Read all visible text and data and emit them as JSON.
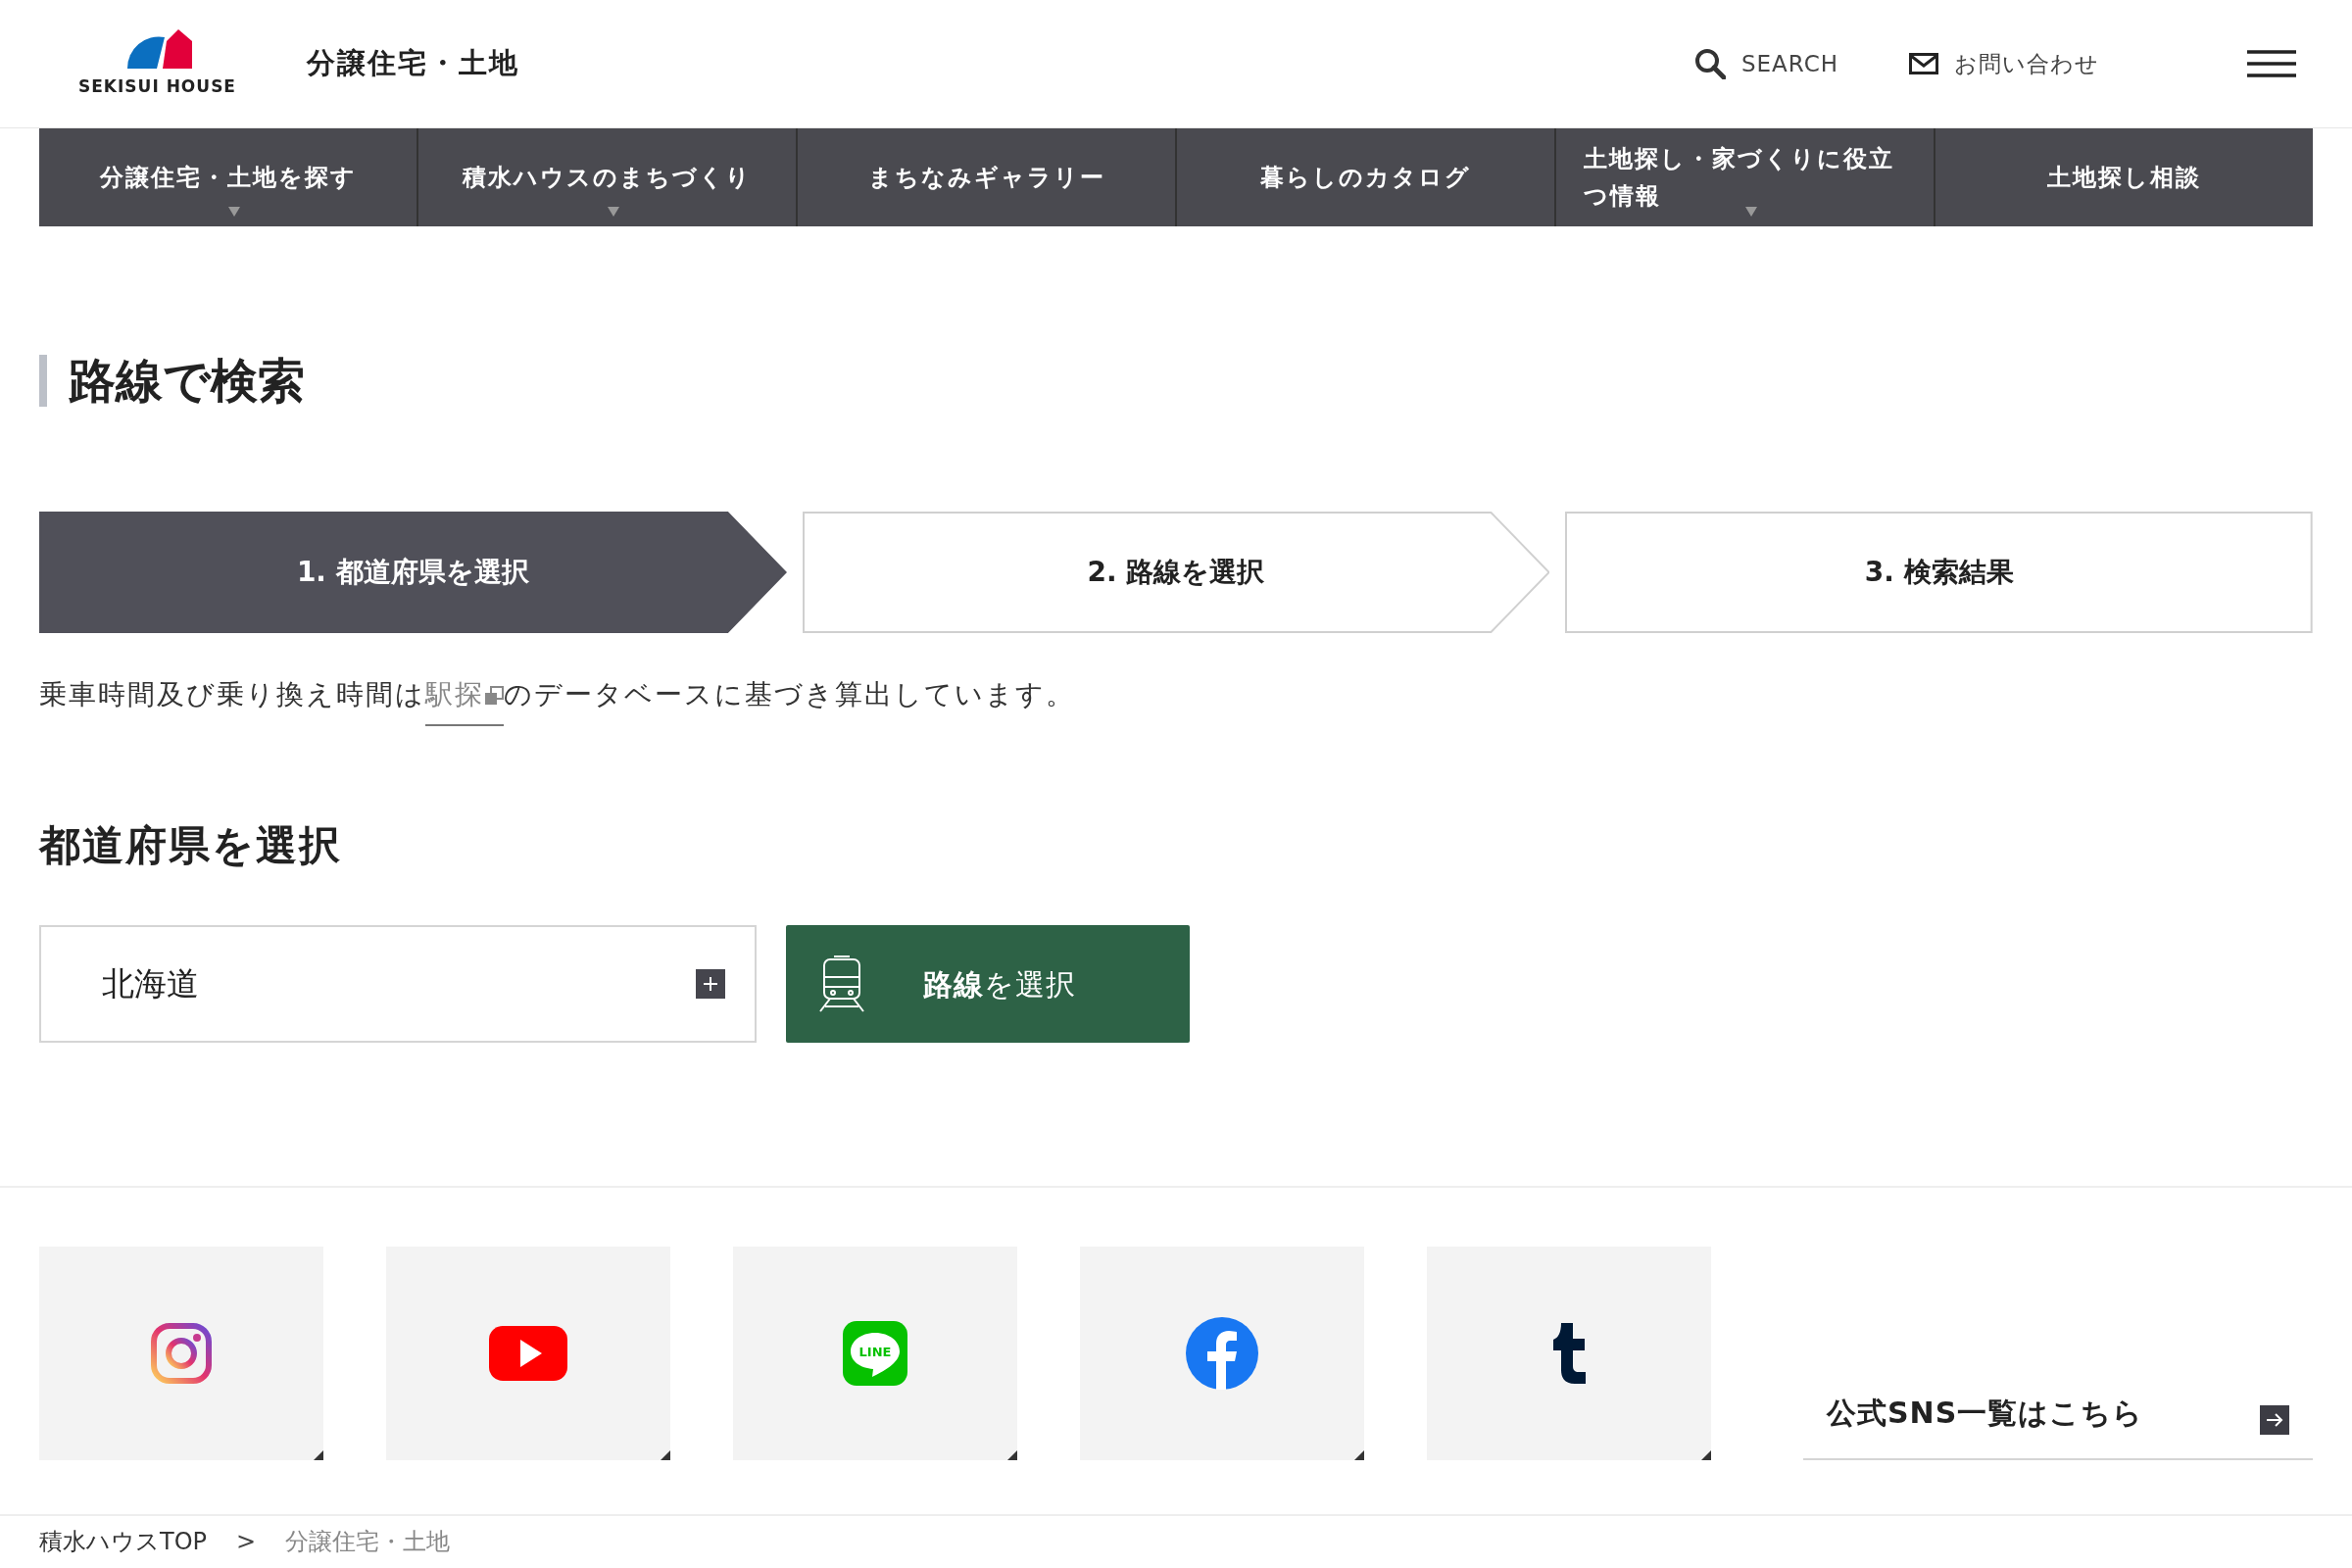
{
  "header": {
    "logo_text": "SEKISUI HOUSE",
    "site_title": "分譲住宅・土地",
    "search_label": "SEARCH",
    "contact_label": "お問い合わせ"
  },
  "nav": [
    {
      "label": "分譲住宅・土地を探す",
      "has_dropdown": true
    },
    {
      "label": "積水ハウスのまちづくり",
      "has_dropdown": true
    },
    {
      "label": "まちなみギャラリー",
      "has_dropdown": false
    },
    {
      "label": "暮らしのカタログ",
      "has_dropdown": false
    },
    {
      "label": "土地探し・家づくりに役立つ情報",
      "has_dropdown": true
    },
    {
      "label": "土地探し相談",
      "has_dropdown": false
    }
  ],
  "page_title": "路線で検索",
  "steps": [
    {
      "label": "1. 都道府県を選択",
      "selected": true,
      "kind": "arrow"
    },
    {
      "label": "2. 路線を選択",
      "selected": false,
      "kind": "arrow"
    },
    {
      "label": "3. 検索結果",
      "selected": false,
      "kind": "end"
    }
  ],
  "note": {
    "before": "乗車時間及び乗り換え時間は",
    "link": "駅探",
    "after": "のデータベースに基づき算出しています。"
  },
  "section_title": "都道府県を選択",
  "prefecture_select": {
    "value": "北海道"
  },
  "route_button": {
    "label": "**路線**を選択"
  },
  "sns": [
    {
      "kind": "instagram"
    },
    {
      "kind": "youtube"
    },
    {
      "kind": "line",
      "icon_text": "LINE"
    },
    {
      "kind": "facebook"
    },
    {
      "kind": "tumblr"
    }
  ],
  "sns_link": "公式SNS一覧はこちら",
  "breadcrumb": [
    {
      "label": "積水ハウスTOP"
    },
    {
      "label": "分譲住宅・土地"
    }
  ],
  "breadcrumb_separator": ">"
}
